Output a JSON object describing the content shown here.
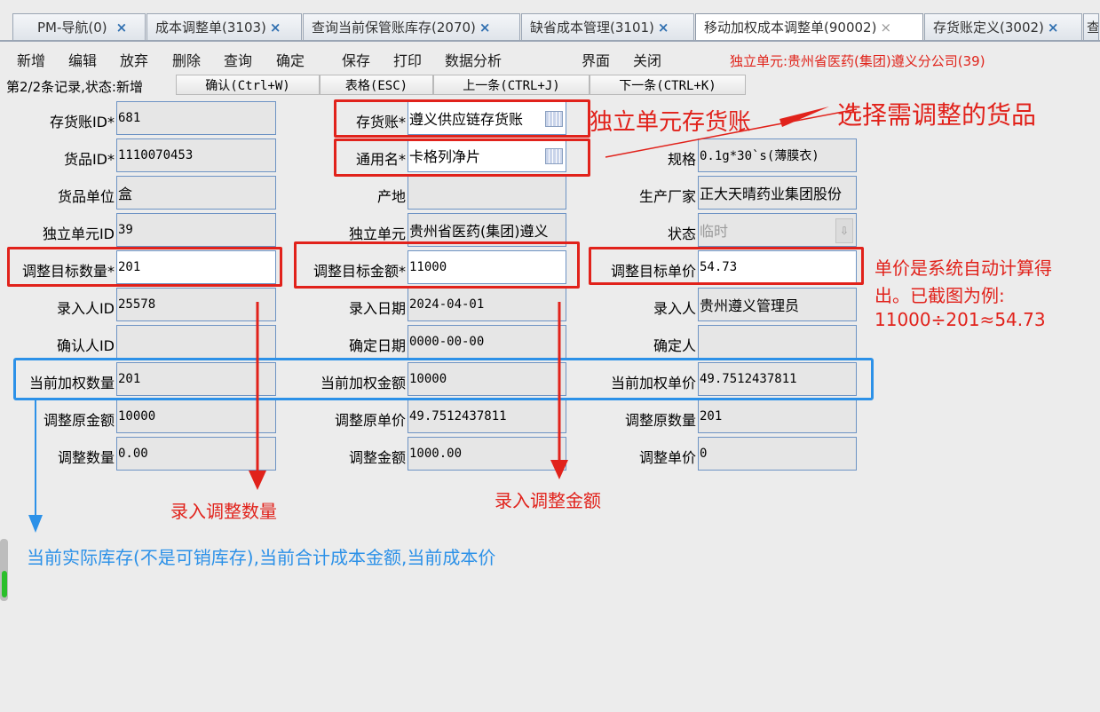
{
  "tabs": [
    {
      "label": "PM-导航(0)",
      "active": false
    },
    {
      "label": "成本调整单(3103)",
      "active": false
    },
    {
      "label": "查询当前保管账库存(2070)",
      "active": false
    },
    {
      "label": "缺省成本管理(3101)",
      "active": false
    },
    {
      "label": "移动加权成本调整单(90002)",
      "active": true
    },
    {
      "label": "存货账定义(3002)",
      "active": false
    },
    {
      "label": "查",
      "active": false
    }
  ],
  "tab_close_glyph": "×",
  "menu": [
    "新增",
    "编辑",
    "放弃",
    "删除",
    "查询",
    "确定",
    "保存",
    "打印",
    "数据分析",
    "界面",
    "关闭"
  ],
  "unit_info": "独立单元:贵州省医药(集团)遵义分公司(39)",
  "status": {
    "record_text": "第2/2条记录,状态:新增",
    "buttons": [
      "确认(Ctrl+W)",
      "表格(ESC)",
      "上一条(CTRL+J)",
      "下一条(CTRL+K)"
    ]
  },
  "form": {
    "account_id": {
      "label": "存货账ID*",
      "value": "681"
    },
    "account": {
      "label": "存货账*",
      "value": "遵义供应链存货账"
    },
    "goods_id": {
      "label": "货品ID*",
      "value": "1110070453"
    },
    "generic_name": {
      "label": "通用名*",
      "value": "卡格列净片"
    },
    "spec": {
      "label": "规格",
      "value": "0.1g*30`s(薄膜衣)"
    },
    "unit": {
      "label": "货品单位",
      "value": "盒"
    },
    "origin": {
      "label": "产地",
      "value": ""
    },
    "manufacturer": {
      "label": "生产厂家",
      "value": "正大天晴药业集团股份"
    },
    "unit_id": {
      "label": "独立单元ID",
      "value": "39"
    },
    "unit_name": {
      "label": "独立单元",
      "value": "贵州省医药(集团)遵义"
    },
    "state": {
      "label": "状态",
      "value": "临时"
    },
    "target_qty": {
      "label": "调整目标数量*",
      "value": "201"
    },
    "target_amount": {
      "label": "调整目标金额*",
      "value": "11000"
    },
    "target_price": {
      "label": "调整目标单价",
      "value": "54.73"
    },
    "entry_user_id": {
      "label": "录入人ID",
      "value": "25578"
    },
    "entry_date": {
      "label": "录入日期",
      "value": "2024-04-01"
    },
    "entry_user": {
      "label": "录入人",
      "value": "贵州遵义管理员"
    },
    "confirm_user_id": {
      "label": "确认人ID",
      "value": ""
    },
    "confirm_date": {
      "label": "确定日期",
      "value": "0000-00-00"
    },
    "confirm_user": {
      "label": "确定人",
      "value": ""
    },
    "cur_qty": {
      "label": "当前加权数量",
      "value": "201"
    },
    "cur_amount": {
      "label": "当前加权金额",
      "value": "10000"
    },
    "cur_price": {
      "label": "当前加权单价",
      "value": "49.7512437811"
    },
    "orig_amount": {
      "label": "调整原金额",
      "value": "10000"
    },
    "orig_price": {
      "label": "调整原单价",
      "value": "49.7512437811"
    },
    "orig_qty": {
      "label": "调整原数量",
      "value": "201"
    },
    "adj_qty": {
      "label": "调整数量",
      "value": "0.00"
    },
    "adj_amount": {
      "label": "调整金额",
      "value": "1000.00"
    },
    "adj_price": {
      "label": "调整单价",
      "value": "0"
    }
  },
  "annotations": {
    "account_note": "独立单元存货账",
    "select_goods": "选择需调整的货品",
    "price_note": [
      "单价是系统自动计算得",
      "出。已截图为例:",
      "11000÷201≈54.73"
    ],
    "enter_qty": "录入调整数量",
    "enter_amount": "录入调整金额",
    "current_note": "当前实际库存(不是可销库存),当前合计成本金额,当前成本价"
  },
  "colors": {
    "annotation_red": "#e1221b",
    "annotation_blue": "#2c91e8",
    "field_border": "#6d93c4",
    "unit_info": "#e0241b"
  }
}
